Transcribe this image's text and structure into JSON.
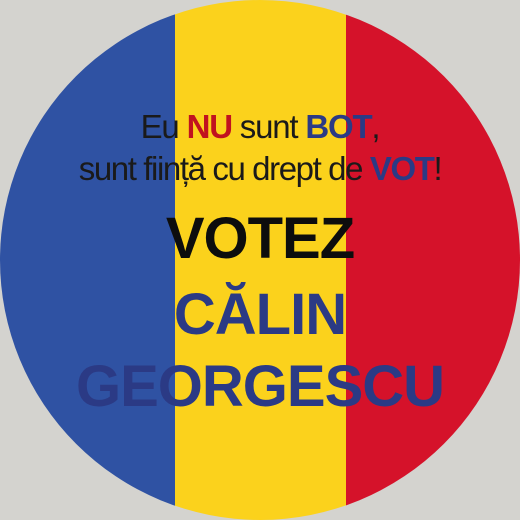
{
  "colors": {
    "background": "#d4d3cf",
    "stripe_blue": "#2f52a3",
    "stripe_yellow": "#fbd21c",
    "stripe_red": "#d5122a",
    "highlight_red": "#c1121f",
    "highlight_blue": "#2b3a85",
    "name_blue": "#2b3a85"
  },
  "badge": {
    "line1": {
      "part1": "Eu ",
      "nu": "NU",
      "part2": " sunt ",
      "bot": "BOT",
      "part3": ","
    },
    "line2": {
      "part1": "sunt ființă cu drept de ",
      "vot": "VOT",
      "part2": "!"
    },
    "votez": "VOTEZ",
    "first_name": "CĂLIN",
    "last_name": "GEORGESCU"
  }
}
